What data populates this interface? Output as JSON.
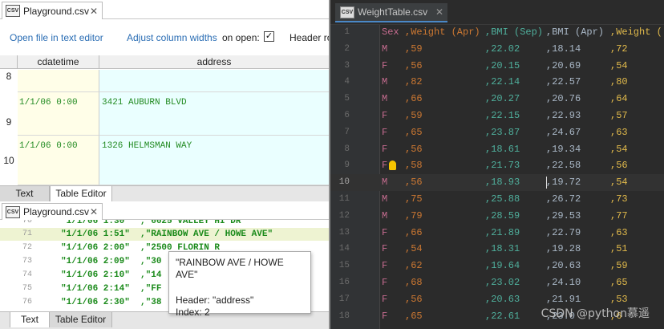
{
  "left_top": {
    "tab_title": "Playground.csv",
    "tab_icon": "csv-file-icon",
    "link_open_text_editor": "Open file in text editor",
    "link_adjust_widths": "Adjust column widths",
    "on_open_label": "on open:",
    "checkbox_checked": "✓",
    "header_row_label": "Header ro",
    "columns": [
      "cdatetime",
      "address"
    ],
    "rows": [
      {
        "num": "8",
        "date": "",
        "address": ""
      },
      {
        "num": "9",
        "date": "1/1/06 0:00",
        "address": "3421 AUBURN BLVD"
      },
      {
        "num": "10",
        "date": "1/1/06 0:00",
        "address": "1326 HELMSMAN WAY"
      }
    ],
    "bottom_tabs": [
      "Text",
      "Table Editor"
    ]
  },
  "left_bottom": {
    "tab_title": "Playground.csv",
    "lines": [
      {
        "n": "70",
        "t": "\"1/1/06 1:30\"  ,\"6625 VALLEY HI DR\""
      },
      {
        "n": "71",
        "t": "\"1/1/06 1:51\"  ,\"RAINBOW AVE / HOWE AVE\""
      },
      {
        "n": "72",
        "t": "\"1/1/06 2:00\"  ,\"2500 FLORIN R"
      },
      {
        "n": "73",
        "t": "\"1/1/06 2:09\"  ,\"30"
      },
      {
        "n": "74",
        "t": "\"1/1/06 2:10\"  ,\"14"
      },
      {
        "n": "75",
        "t": "\"1/1/06 2:14\"  ,\"FF"
      },
      {
        "n": "76",
        "t": "\"1/1/06 2:30\"  ,\"38"
      }
    ],
    "tooltip": {
      "value": "\"RAINBOW AVE / HOWE AVE\"",
      "header": "Header: \"address\"",
      "index": "Index: 2"
    },
    "bottom_tabs": [
      "Text",
      "Table Editor"
    ]
  },
  "right": {
    "tab_title": "WeightTable.csv",
    "header": [
      "Sex",
      ",Weight (Apr)",
      ",BMI (Sep)",
      ",BMI (Apr)",
      ",Weight ("
    ],
    "rows": [
      [
        "M",
        ",59",
        ",22.02",
        ",18.14",
        ",72"
      ],
      [
        "F",
        ",56",
        ",20.15",
        ",20.69",
        ",54"
      ],
      [
        "M",
        ",82",
        ",22.14",
        ",22.57",
        ",80"
      ],
      [
        "M",
        ",66",
        ",20.27",
        ",20.76",
        ",64"
      ],
      [
        "F",
        ",59",
        ",22.15",
        ",22.93",
        ",57"
      ],
      [
        "F",
        ",65",
        ",23.87",
        ",24.67",
        ",63"
      ],
      [
        "F",
        ",56",
        ",18.61",
        ",19.34",
        ",54"
      ],
      [
        "F",
        ",58",
        ",21.73",
        ",22.58",
        ",56"
      ],
      [
        "M",
        ",56",
        ",18.93",
        ",19.72",
        ",54"
      ],
      [
        "M",
        ",75",
        ",25.88",
        ",26.72",
        ",73"
      ],
      [
        "M",
        ",79",
        ",28.59",
        ",29.53",
        ",77"
      ],
      [
        "F",
        ",66",
        ",21.89",
        ",22.79",
        ",63"
      ],
      [
        "F",
        ",54",
        ",18.31",
        ",19.28",
        ",51"
      ],
      [
        "F",
        ",62",
        ",19.64",
        ",20.63",
        ",59"
      ],
      [
        "F",
        ",68",
        ",23.02",
        ",24.10",
        ",65"
      ],
      [
        "F",
        ",56",
        ",20.63",
        ",21.91",
        ",53"
      ],
      [
        "F",
        ",65",
        ",22.61",
        ",23.0",
        ",6"
      ]
    ],
    "column_colors": [
      "#c46b8e",
      "#cc7832",
      "#4faf9c",
      "#a9b7c6",
      "#e0b94b"
    ],
    "watermark": "CSDN @python慕遥"
  }
}
